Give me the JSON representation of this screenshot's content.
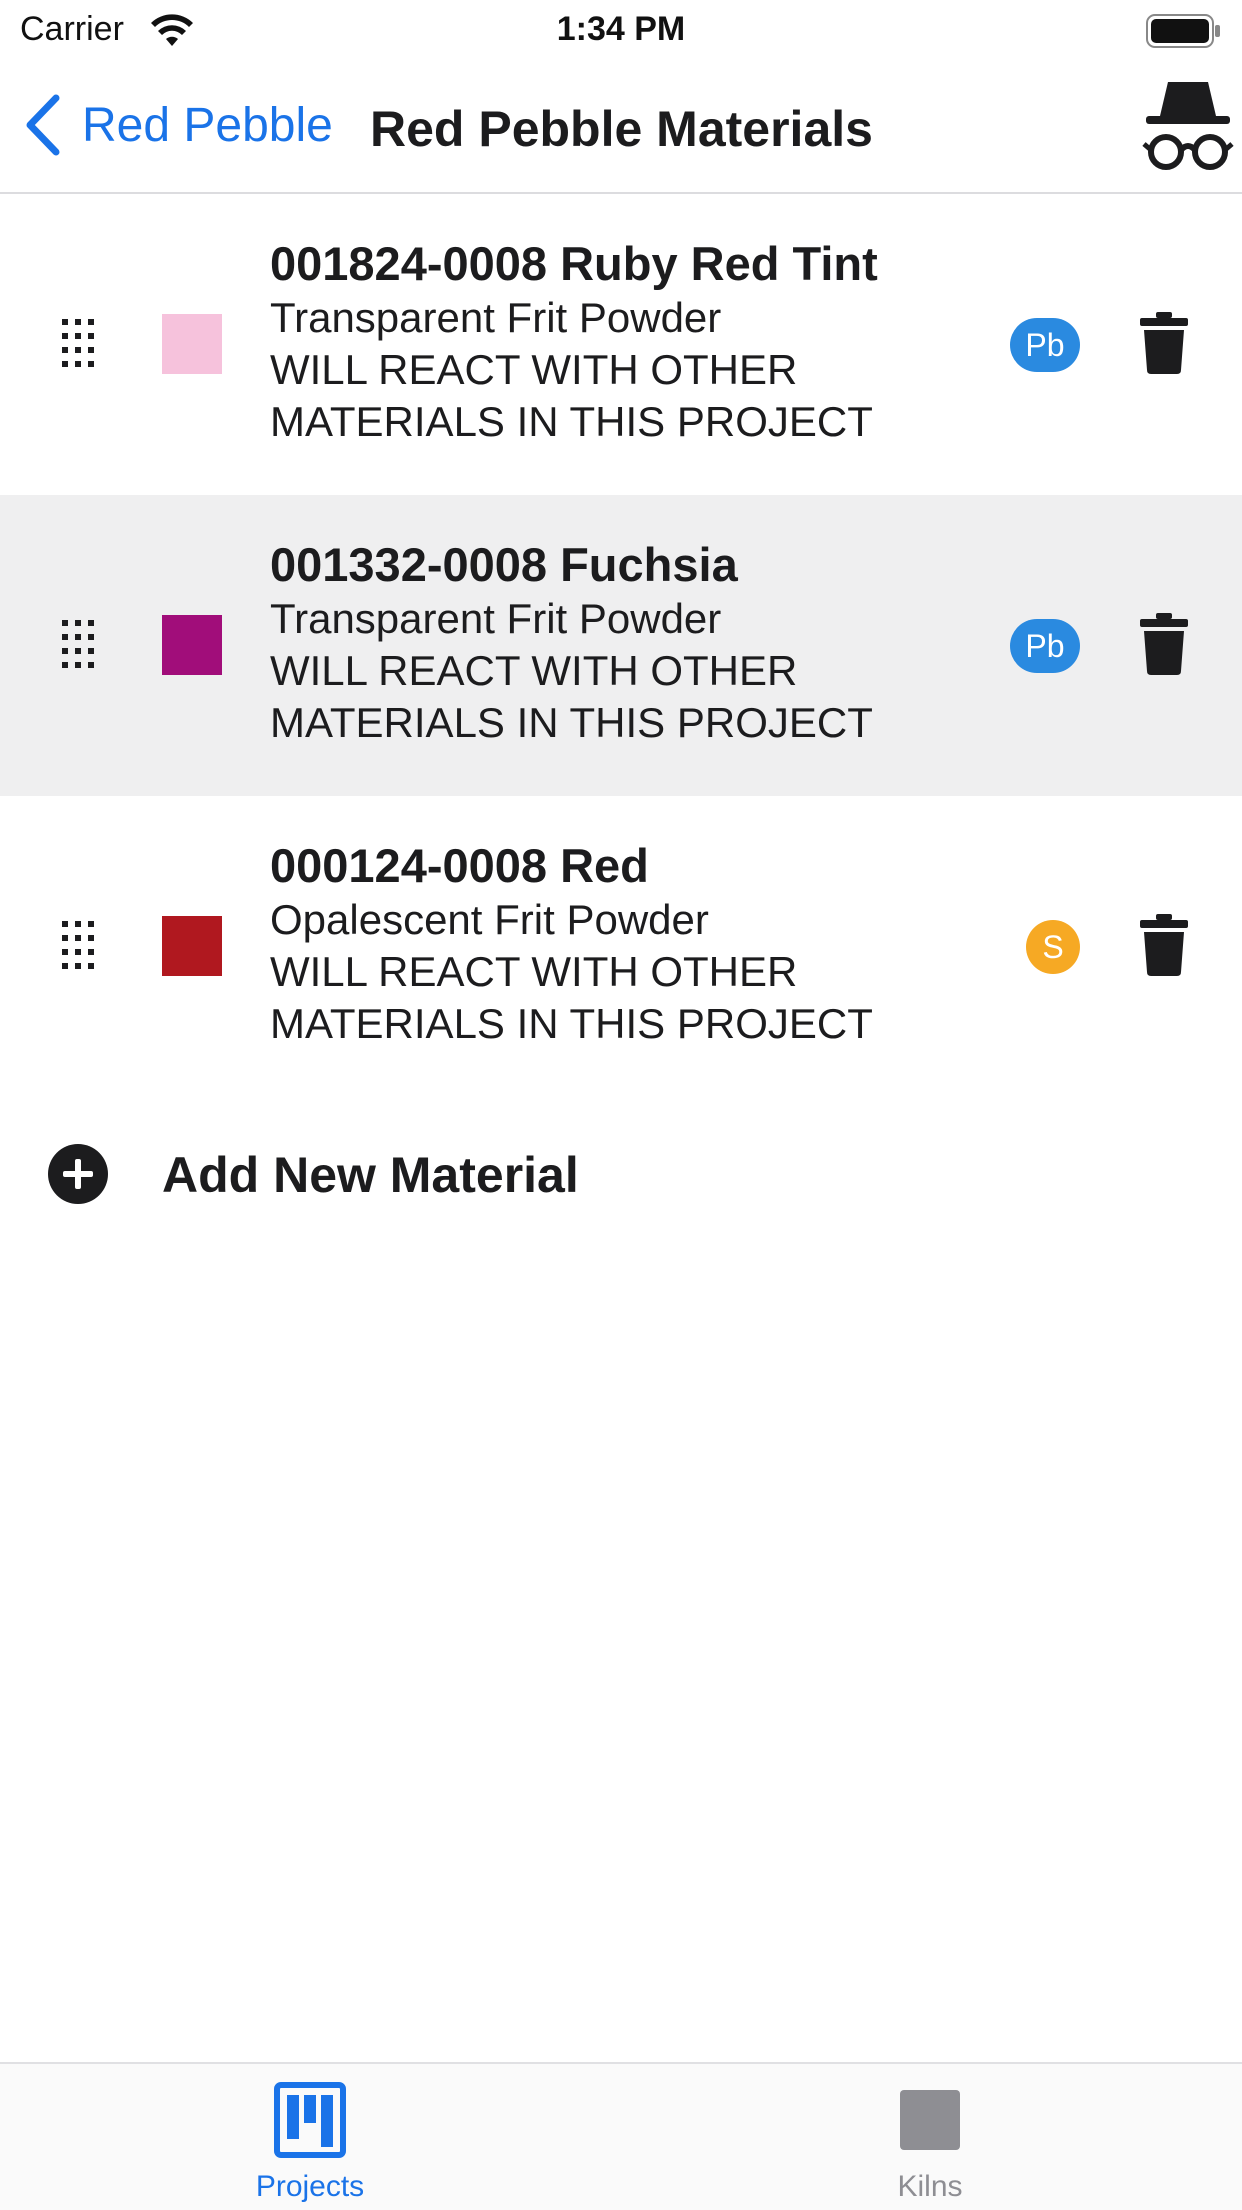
{
  "status_bar": {
    "carrier": "Carrier",
    "time": "1:34 PM"
  },
  "nav": {
    "back_label": "Red Pebble",
    "title": "Red Pebble Materials",
    "right_icon": "incognito-spy-icon"
  },
  "materials": [
    {
      "title": "001824-0008 Ruby Red Tint",
      "type": "Transparent Frit Powder",
      "warning_line1": "WILL REACT WITH OTHER",
      "warning_line2": "MATERIALS IN THIS PROJECT",
      "swatch_color": "#f6c2dc",
      "badge": "Pb",
      "badge_color": "#2a8ae0",
      "selected": false
    },
    {
      "title": "001332-0008 Fuchsia",
      "type": "Transparent Frit Powder",
      "warning_line1": "WILL REACT WITH OTHER",
      "warning_line2": "MATERIALS IN THIS PROJECT",
      "swatch_color": "#a10d7a",
      "badge": "Pb",
      "badge_color": "#2a8ae0",
      "selected": true
    },
    {
      "title": "000124-0008 Red",
      "type": "Opalescent Frit Powder",
      "warning_line1": "WILL REACT WITH OTHER",
      "warning_line2": "MATERIALS IN THIS PROJECT",
      "swatch_color": "#b0181f",
      "badge": "S",
      "badge_color": "#f6a924",
      "selected": false
    }
  ],
  "add_material_label": "Add New Material",
  "tabs": [
    {
      "label": "Projects",
      "icon": "projects-board-icon",
      "active": true
    },
    {
      "label": "Kilns",
      "icon": "kiln-icon",
      "active": false
    }
  ],
  "colors": {
    "accent": "#1a73e8",
    "selected_row_bg": "#efeff0",
    "inactive_tab": "#8e8e93"
  }
}
